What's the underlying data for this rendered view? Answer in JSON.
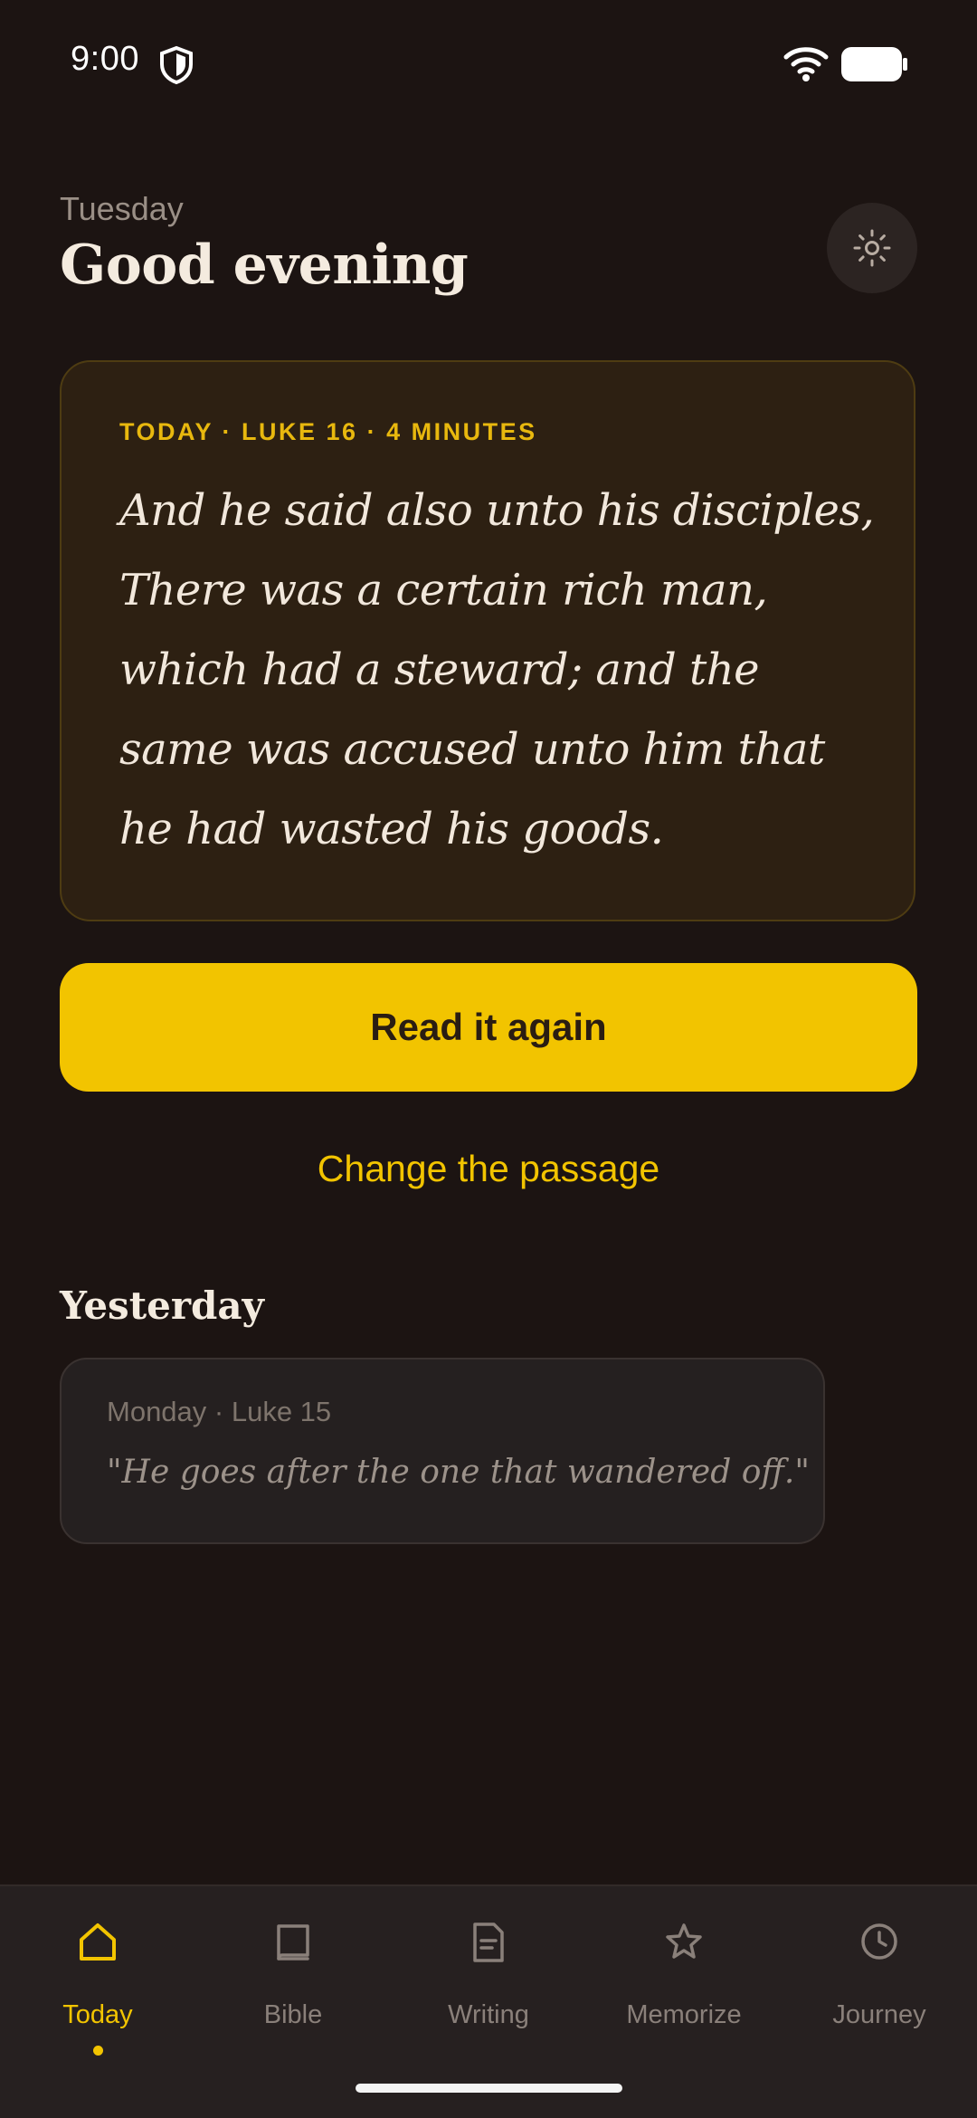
{
  "status_bar": {
    "time": "9:00",
    "icons": [
      "shield-icon",
      "wifi-icon",
      "battery-icon"
    ]
  },
  "header": {
    "day": "Tuesday",
    "greeting": "Good evening",
    "theme_toggle_icon": "sun-icon"
  },
  "passage_card": {
    "meta": "TODAY · LUKE 16 · 4 MINUTES",
    "text": "And he said also unto his disciples, There was a certain rich man, which had a steward; and the same was accused unto him that he had wasted his goods."
  },
  "actions": {
    "read_again": "Read it again",
    "change_passage": "Change the passage"
  },
  "yesterday": {
    "heading": "Yesterday",
    "meta": "Monday · Luke 15",
    "quote": "\"He goes after the one that wandered off.\""
  },
  "nav": {
    "items": [
      {
        "label": "Today",
        "icon": "home-icon",
        "active": true
      },
      {
        "label": "Bible",
        "icon": "book-icon",
        "active": false
      },
      {
        "label": "Writing",
        "icon": "document-icon",
        "active": false
      },
      {
        "label": "Memorize",
        "icon": "star-icon",
        "active": false
      },
      {
        "label": "Journey",
        "icon": "clock-icon",
        "active": false
      }
    ]
  },
  "colors": {
    "background": "#1c1412",
    "accent": "#f2c400",
    "card": "#2d2012",
    "nav_bg": "#262020"
  }
}
